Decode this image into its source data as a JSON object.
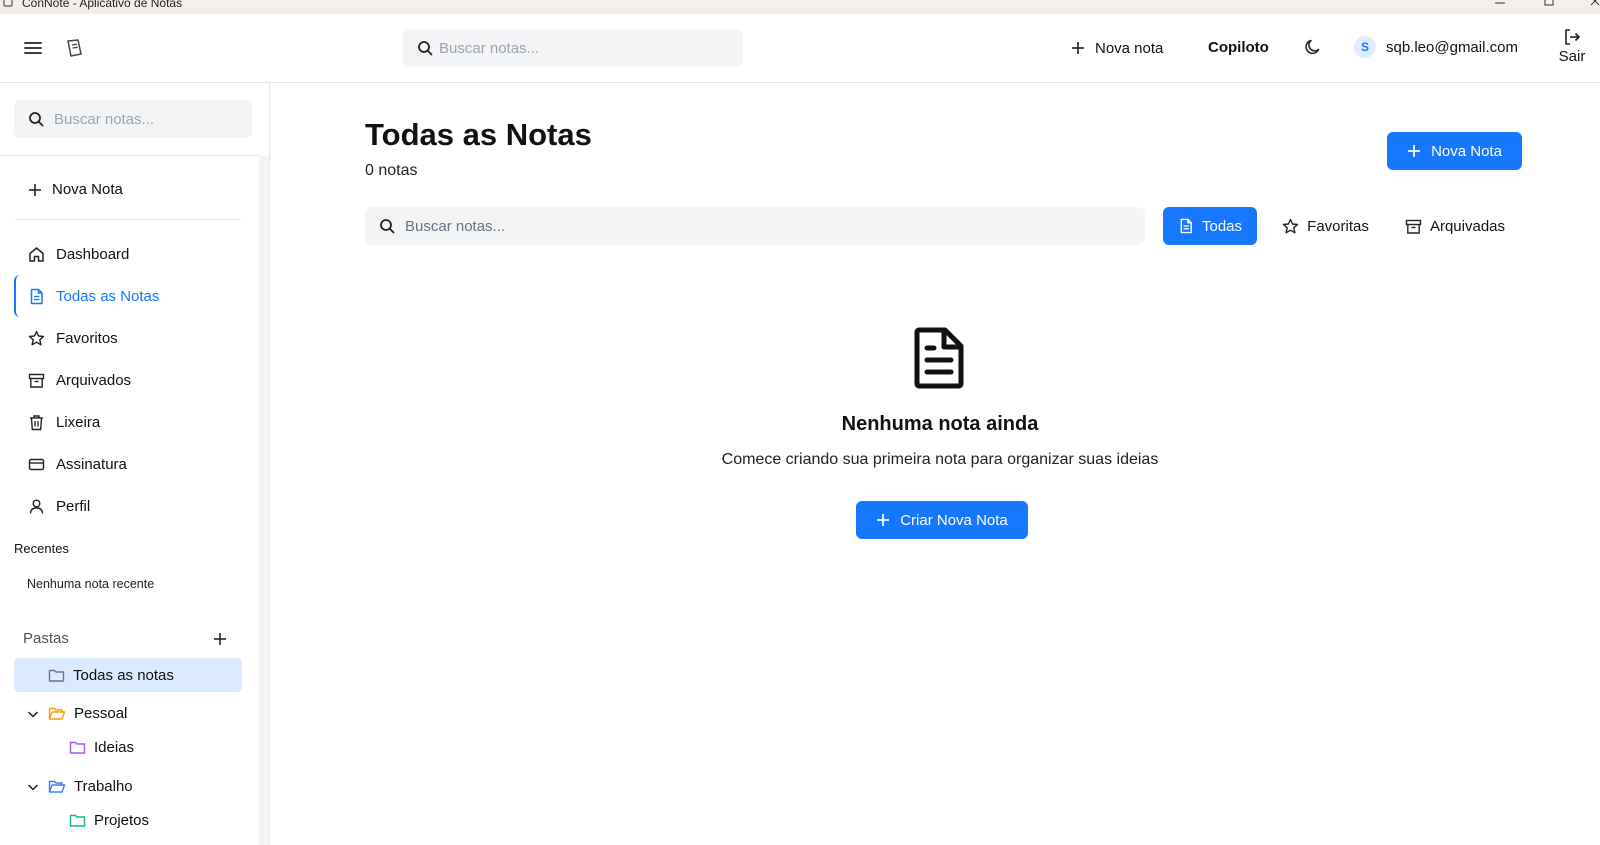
{
  "window": {
    "title": "ConNote - Aplicativo de Notas"
  },
  "header": {
    "search_placeholder": "Buscar notas...",
    "new_note_label": "Nova nota",
    "copilot_label": "Copiloto",
    "user_initial": "S",
    "user_email": "sqb.leo@gmail.com",
    "logout_label": "Sair"
  },
  "sidebar": {
    "search_placeholder": "Buscar notas...",
    "new_note_label": "Nova Nota",
    "nav": [
      {
        "label": "Dashboard",
        "icon": "home-icon"
      },
      {
        "label": "Todas as Notas",
        "icon": "document-icon",
        "active": true
      },
      {
        "label": "Favoritos",
        "icon": "star-icon"
      },
      {
        "label": "Arquivados",
        "icon": "archive-icon"
      },
      {
        "label": "Lixeira",
        "icon": "trash-icon"
      },
      {
        "label": "Assinatura",
        "icon": "credit-card-icon"
      },
      {
        "label": "Perfil",
        "icon": "user-icon"
      }
    ],
    "recent_title": "Recentes",
    "recent_empty": "Nenhuma nota recente",
    "folders_title": "Pastas",
    "folders": [
      {
        "label": "Todas as notas",
        "color": "#6b7280",
        "selected": true
      },
      {
        "label": "Pessoal",
        "color": "#f59e0b",
        "expanded": true
      },
      {
        "label": "Ideias",
        "color": "#a855f7"
      },
      {
        "label": "Trabalho",
        "color": "#3b82f6",
        "expanded": true
      },
      {
        "label": "Projetos",
        "color": "#10b981"
      }
    ]
  },
  "main": {
    "title": "Todas as Notas",
    "count": "0 notas",
    "new_note_button": "Nova Nota",
    "search_placeholder": "Buscar notas...",
    "tabs": [
      {
        "label": "Todas",
        "icon": "document-icon",
        "active": true
      },
      {
        "label": "Favoritas",
        "icon": "star-icon"
      },
      {
        "label": "Arquivadas",
        "icon": "archive-icon"
      }
    ],
    "empty_title": "Nenhuma nota ainda",
    "empty_description": "Comece criando sua primeira nota para organizar suas ideias",
    "create_button": "Criar Nova Nota"
  },
  "colors": {
    "primary": "#1677ff",
    "selected_folder_bg": "#dbeafe",
    "border": "#e5e7eb",
    "input_bg": "#f3f4f6"
  }
}
